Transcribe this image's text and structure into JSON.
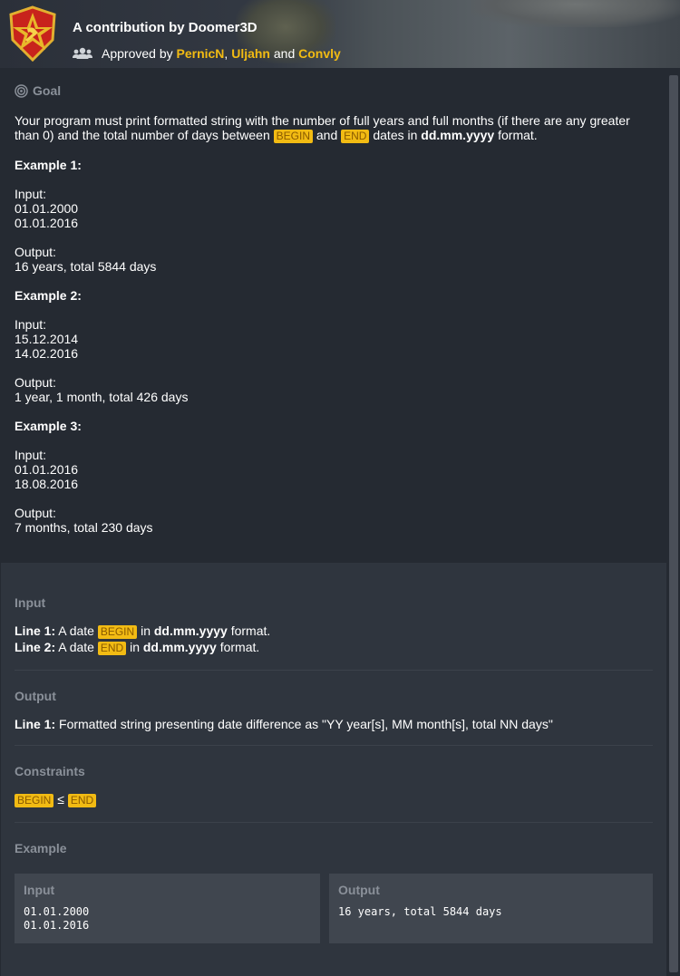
{
  "header": {
    "title": "A contribution by Doomer3D",
    "approved_prefix": "Approved by",
    "approvers": [
      "PernicN",
      "Uljahn",
      "Convly"
    ],
    "sep_comma": ",",
    "sep_and": "and"
  },
  "goal": {
    "heading": "Goal",
    "intro_before": "Your program must print formatted string with the number of full years and full months (if there are any greater than 0) and the total number of days between",
    "begin": "BEGIN",
    "and": "and",
    "end": "END",
    "dates_in": "dates in",
    "format": "dd.mm.yyyy",
    "format_suffix": "format.",
    "examples": [
      {
        "title": "Example 1:",
        "input_label": "Input:",
        "input": [
          "01.01.2000",
          "01.01.2016"
        ],
        "output_label": "Output:",
        "output": "16 years, total 5844 days"
      },
      {
        "title": "Example 2:",
        "input_label": "Input:",
        "input": [
          "15.12.2014",
          "14.02.2016"
        ],
        "output_label": "Output:",
        "output": "1 year, 1 month, total 426 days"
      },
      {
        "title": "Example 3:",
        "input_label": "Input:",
        "input": [
          "01.01.2016",
          "18.08.2016"
        ],
        "output_label": "Output:",
        "output": "7 months, total 230 days"
      }
    ]
  },
  "input_section": {
    "title": "Input",
    "line1_label": "Line 1:",
    "line1_a": "A date",
    "line1_kw": "BEGIN",
    "line1_in": "in",
    "line1_fmt": "dd.mm.yyyy",
    "line1_suffix": "format.",
    "line2_label": "Line 2:",
    "line2_a": "A date",
    "line2_kw": "END",
    "line2_in": "in",
    "line2_fmt": "dd.mm.yyyy",
    "line2_suffix": "format."
  },
  "output_section": {
    "title": "Output",
    "line1_label": "Line 1:",
    "line1_text": "Formatted string presenting date difference as \"YY year[s], MM month[s], total NN days\""
  },
  "constraints": {
    "title": "Constraints",
    "left": "BEGIN",
    "op": "≤",
    "right": "END"
  },
  "example": {
    "title": "Example",
    "input_label": "Input",
    "input_text": "01.01.2000\n01.01.2016",
    "output_label": "Output",
    "output_text": "16 years, total 5844 days"
  },
  "colors": {
    "accent": "#f2bb13",
    "muted": "#8a9099",
    "panel_dark": "#252a32",
    "panel_light": "#2f353e"
  },
  "icons": [
    "emblem-logo",
    "users-icon",
    "target-icon"
  ]
}
